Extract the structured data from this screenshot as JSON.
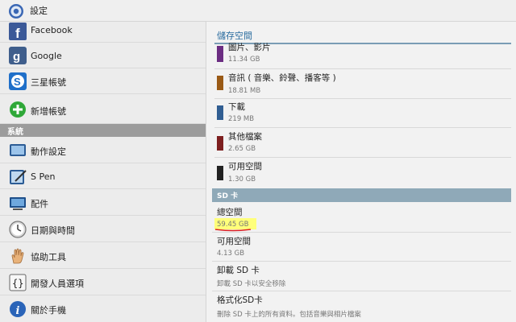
{
  "titlebar": {
    "title": "設定"
  },
  "sidebar": {
    "items_top": [
      {
        "label": "Facebook",
        "icon": "facebook-icon"
      },
      {
        "label": "Google",
        "icon": "google-icon"
      },
      {
        "label": "三星帳號",
        "icon": "samsung-account-icon"
      },
      {
        "label": "新增帳號",
        "icon": "add-icon"
      }
    ],
    "section_label": "系統",
    "items_system": [
      {
        "label": "動作設定",
        "icon": "motion-icon"
      },
      {
        "label": "S Pen",
        "icon": "s-pen-icon"
      },
      {
        "label": "配件",
        "icon": "accessory-icon"
      },
      {
        "label": "日期與時間",
        "icon": "clock-icon"
      },
      {
        "label": "協助工具",
        "icon": "hand-icon"
      },
      {
        "label": "開發人員選項",
        "icon": "developer-braces-icon"
      },
      {
        "label": "關於手機",
        "icon": "info-icon"
      }
    ]
  },
  "storage": {
    "title": "儲存空間",
    "items": [
      {
        "name": "圖片、影片",
        "value": "11.34 GB",
        "color": "#6b2d82"
      },
      {
        "name": "音訊 ( 音樂、鈴聲、播客等 )",
        "value": "18.81 MB",
        "color": "#9a5a16"
      },
      {
        "name": "下載",
        "value": "219 MB",
        "color": "#315e92"
      },
      {
        "name": "其他檔案",
        "value": "2.65 GB",
        "color": "#7d1f1f"
      },
      {
        "name": "可用空間",
        "value": "1.30 GB",
        "color": "#222222"
      }
    ]
  },
  "sd_card": {
    "header": "SD 卡",
    "total_label": "總空間",
    "total_value": "59.45 GB",
    "available_label": "可用空間",
    "available_value": "4.13 GB",
    "unmount_label": "卸載 SD 卡",
    "unmount_desc": "卸載 SD 卡以安全移除",
    "format_label": "格式化SD卡",
    "format_desc": "刪除 SD 卡上的所有資料。包括音樂與相片檔案"
  }
}
